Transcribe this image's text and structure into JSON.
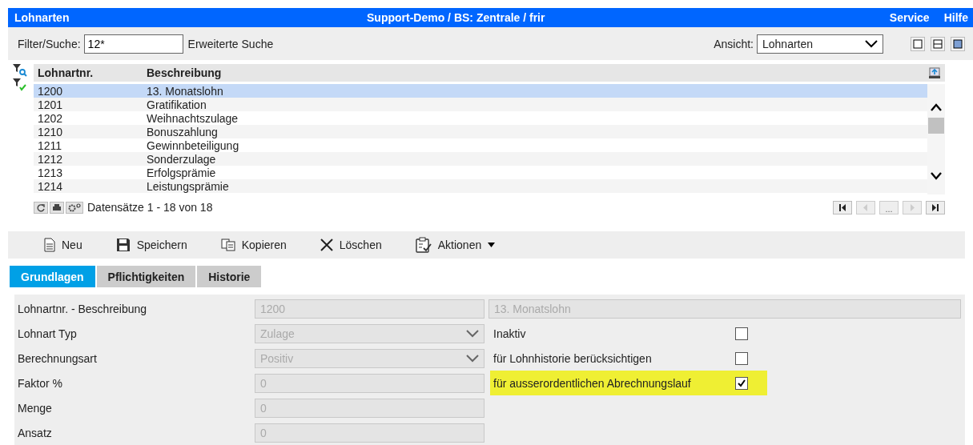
{
  "title_bar": {
    "module": "Lohnarten",
    "context": "Support-Demo / BS: Zentrale / frir",
    "menu": [
      "Service",
      "Hilfe"
    ]
  },
  "filter": {
    "label": "Filter/Suche:",
    "value": "12*",
    "advanced_link": "Erweiterte Suche",
    "view_label": "Ansicht:",
    "view_value": "Lohnarten"
  },
  "table": {
    "columns": [
      "Lohnartnr.",
      "Beschreibung"
    ],
    "rows": [
      {
        "number": "1200",
        "description": "13. Monatslohn",
        "selected": true
      },
      {
        "number": "1201",
        "description": "Gratifikation",
        "selected": false
      },
      {
        "number": "1202",
        "description": "Weihnachtszulage",
        "selected": false
      },
      {
        "number": "1210",
        "description": "Bonuszahlung",
        "selected": false
      },
      {
        "number": "1211",
        "description": "Gewinnbeteiligung",
        "selected": false
      },
      {
        "number": "1212",
        "description": "Sonderzulage",
        "selected": false
      },
      {
        "number": "1213",
        "description": "Erfolgsprämie",
        "selected": false
      },
      {
        "number": "1214",
        "description": "Leistungsprämie",
        "selected": false
      }
    ],
    "record_count": "Datensätze 1 - 18 von 18",
    "pager_ellipsis": "..."
  },
  "toolbar": [
    {
      "label": "Neu",
      "kind": "new"
    },
    {
      "label": "Speichern",
      "kind": "save"
    },
    {
      "label": "Kopieren",
      "kind": "copy"
    },
    {
      "label": "Löschen",
      "kind": "delete"
    },
    {
      "label": "Aktionen",
      "kind": "actions"
    }
  ],
  "tabs": [
    {
      "label": "Grundlagen",
      "selected": true
    },
    {
      "label": "Pflichtigkeiten",
      "selected": false
    },
    {
      "label": "Historie",
      "selected": false
    }
  ],
  "form": {
    "fields": [
      {
        "label": "Lohnartnr. - Beschreibung",
        "value": "1200",
        "kind": "text",
        "extra_value": "13. Monatslohn",
        "disabled": true
      },
      {
        "label": "Lohnart Typ",
        "value": "Zulage",
        "kind": "select",
        "disabled": true
      },
      {
        "label": "Berechnungsart",
        "value": "Positiv",
        "kind": "select",
        "disabled": true
      },
      {
        "label": "Faktor %",
        "value": "0",
        "kind": "text",
        "disabled": true
      },
      {
        "label": "Menge",
        "value": "0",
        "kind": "text",
        "disabled": true
      },
      {
        "label": "Ansatz",
        "value": "0",
        "kind": "text",
        "disabled": true
      }
    ],
    "checkboxes": [
      {
        "label": "Inaktiv",
        "checked": false,
        "highlighted": false
      },
      {
        "label": "für Lohnhistorie berücksichtigen",
        "checked": false,
        "highlighted": false
      },
      {
        "label": "für ausserordentlichen Abrechnungslauf",
        "checked": true,
        "highlighted": true
      }
    ]
  }
}
